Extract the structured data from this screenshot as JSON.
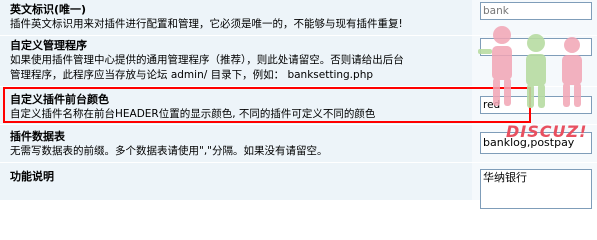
{
  "rows": [
    {
      "title": "英文标识(唯一)",
      "desc": "插件英文标识用来对插件进行配置和管理，它必须是唯一的，不能够与现有插件重复!",
      "value": "bank"
    },
    {
      "title": "自定义管理程序",
      "desc1": "如果使用插件管理中心提供的通用管理程序（推荐），则此处请留空。否则请给出后台",
      "desc2": "管理程序，此程序应当存放与论坛 admin/ 目录下，例如： banksetting.php",
      "value": ""
    },
    {
      "title": "自定义插件前台颜色",
      "desc": "自定义插件名称在前台HEADER位置的显示颜色, 不同的插件可定义不同的颜色",
      "value": "red"
    },
    {
      "title": "插件数据表",
      "desc": "无需写数据表的前缀。多个数据表请使用\",\"分隔。如果没有请留空。",
      "value": "banklog,postpay"
    },
    {
      "title": "功能说明",
      "value": "华纳银行"
    }
  ],
  "watermark": {
    "text": "DISCUZ!",
    "colors": {
      "pink": "#f2a5b5",
      "green": "#b8dca2",
      "red": "#e85060"
    }
  },
  "highlight_color": "#ff0000"
}
